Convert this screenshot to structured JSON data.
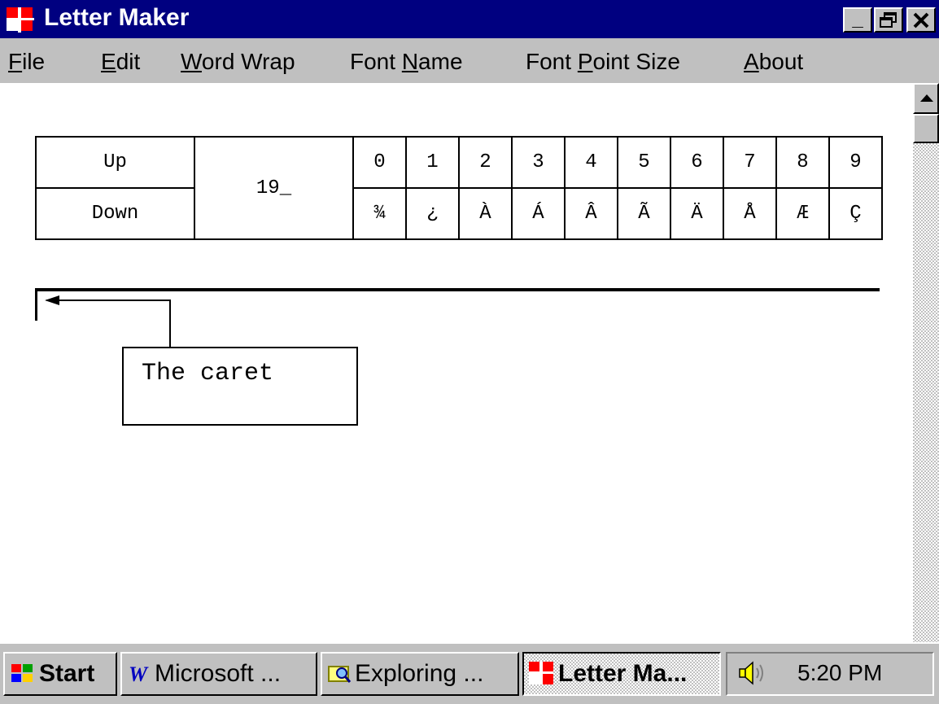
{
  "window": {
    "title": "Letter Maker",
    "controls": {
      "minimize": "_",
      "maximize": "❐",
      "close": "✕"
    }
  },
  "menu": {
    "items": [
      {
        "key": "file",
        "label": "File",
        "mnemonic": "F"
      },
      {
        "key": "edit",
        "label": "Edit",
        "mnemonic": "E"
      },
      {
        "key": "word_wrap",
        "label": "Word Wrap",
        "mnemonic": "W"
      },
      {
        "key": "font_name",
        "label": "Font Name",
        "mnemonic": "N"
      },
      {
        "key": "font_point_size",
        "label": "Font Point Size",
        "mnemonic": "P"
      },
      {
        "key": "about",
        "label": "About",
        "mnemonic": "A"
      }
    ]
  },
  "keypad": {
    "up_label": "Up",
    "down_label": "Down",
    "code_prefix": "19_",
    "digits": [
      "0",
      "1",
      "2",
      "3",
      "4",
      "5",
      "6",
      "7",
      "8",
      "9"
    ],
    "chars": [
      "¾",
      "¿",
      "À",
      "Á",
      "Â",
      "Ã",
      "Ä",
      "Å",
      "Æ",
      "Ç"
    ]
  },
  "annotation": {
    "callout_text": "The caret"
  },
  "taskbar": {
    "start_label": "Start",
    "tasks": [
      {
        "key": "word",
        "label": "Microsoft ..."
      },
      {
        "key": "explorer",
        "label": "Exploring ..."
      },
      {
        "key": "letter",
        "label": "Letter Ma..."
      }
    ],
    "clock": "5:20 PM"
  },
  "colors": {
    "title_bar": "#000080",
    "face": "#c0c0c0",
    "app_icon_red": "#ff0000"
  }
}
